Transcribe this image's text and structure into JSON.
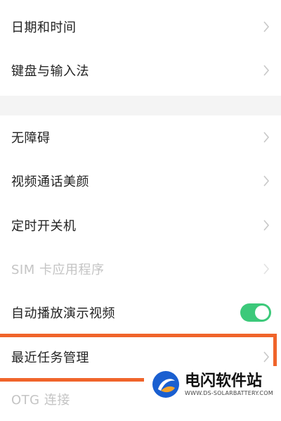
{
  "settings": {
    "items": [
      {
        "label": "日期和时间"
      },
      {
        "label": "键盘与输入法"
      },
      {
        "label": "无障碍"
      },
      {
        "label": "视频通话美颜"
      },
      {
        "label": "定时开关机"
      },
      {
        "label": "SIM 卡应用程序"
      },
      {
        "label": "自动播放演示视频"
      },
      {
        "label": "最近任务管理"
      },
      {
        "label": "OTG 连接"
      }
    ],
    "toggle_color": "#3cc97a",
    "highlight_color": "#f0642a"
  },
  "watermark": {
    "title": "电闪软件站",
    "url": "WWW.DS-SOLARBATTERY.COM"
  }
}
